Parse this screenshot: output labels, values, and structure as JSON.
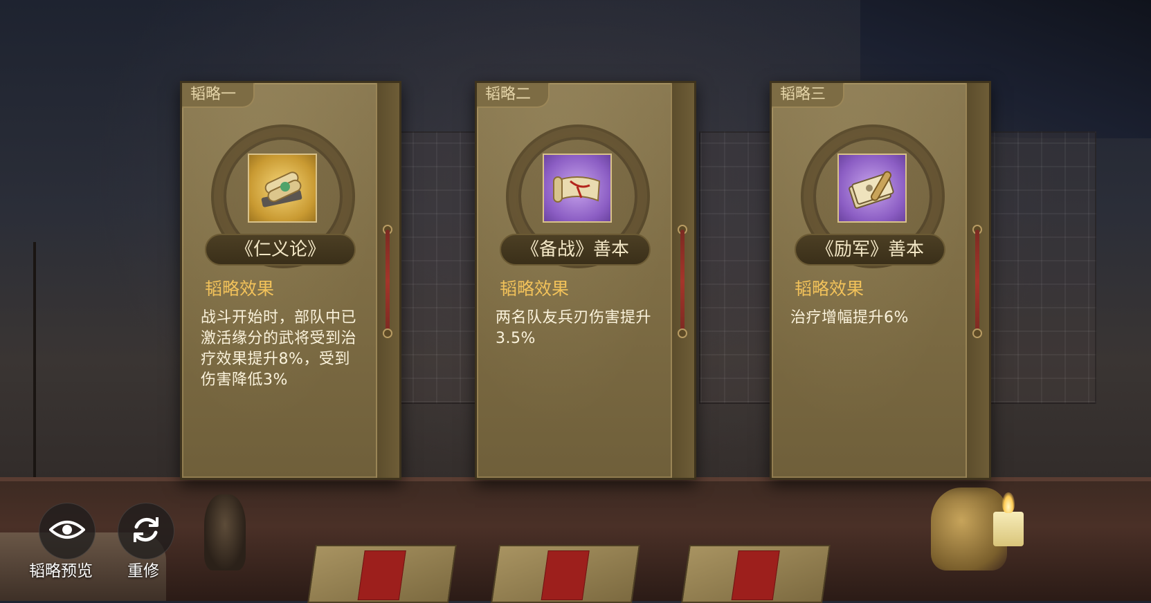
{
  "cards": [
    {
      "tab": "韬略一",
      "name": "《仁义论》",
      "effect_title": "韬略效果",
      "effect_text": "战斗开始时，部队中已激活缘分的武将受到治疗效果提升8%，受到伤害降低3%",
      "rarity_color": "#c99a32",
      "icon": "scroll-bundle-icon"
    },
    {
      "tab": "韬略二",
      "name": "《备战》善本",
      "effect_title": "韬略效果",
      "effect_text": "两名队友兵刃伤害提升3.5%",
      "rarity_color": "#8c5ec4",
      "icon": "open-scroll-icon"
    },
    {
      "tab": "韬略三",
      "name": "《励军》善本",
      "effect_title": "韬略效果",
      "effect_text": "治疗增幅提升6%",
      "rarity_color": "#8c5ec4",
      "icon": "book-scroll-icon"
    }
  ],
  "controls": {
    "preview_label": "韬略预览",
    "preview_icon": "eye-icon",
    "reforge_label": "重修",
    "reforge_icon": "refresh-icon"
  },
  "colors": {
    "effect_title": "#f2c25a",
    "card_bg": "#7d6c44",
    "seal_red": "#9d1f1c"
  }
}
